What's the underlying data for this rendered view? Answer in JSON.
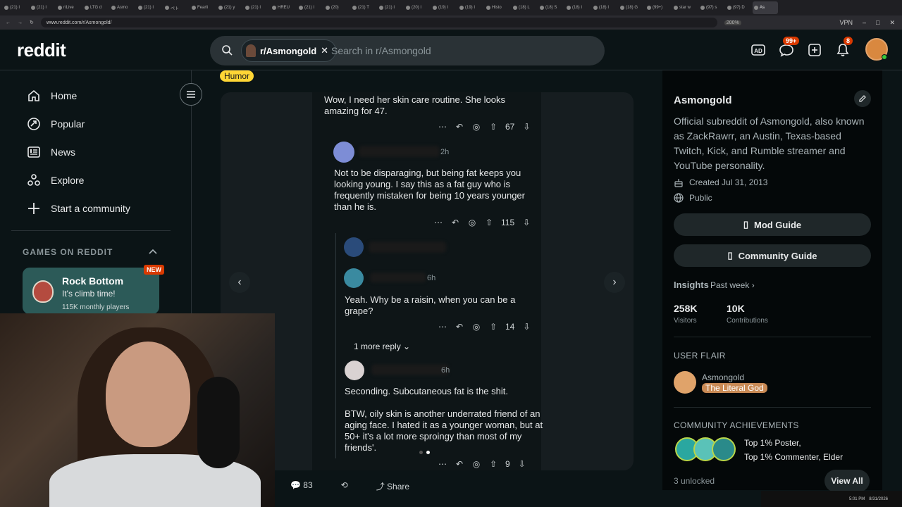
{
  "browser": {
    "tabs": [
      "(21) I",
      "(21) I",
      "r/Live",
      "LTG d",
      "Asmo",
      "(21) I",
      "ペト",
      "Fearli",
      "(21) y",
      "(21) I",
      "HREU",
      "(21) I",
      "(20)",
      "(21) T",
      "(21) I",
      "(20) I",
      "(19) I",
      "(19) I",
      "Histo",
      "(18) L",
      "(18) S",
      "(18) I",
      "(18) I",
      "(18) G",
      "(99+)",
      "star w",
      "(97) s",
      "(97) D",
      "As"
    ],
    "url": "www.reddit.com/r/Asmongold/",
    "zoom": "200%",
    "vpn": "VPN"
  },
  "header": {
    "logo": "reddit",
    "search_chip": "r/Asmongold",
    "search_placeholder": "Search in r/Asmongold",
    "chat_badge": "99+",
    "notif_badge": "8"
  },
  "leftnav": {
    "items": [
      {
        "label": "Home",
        "icon": "home-icon"
      },
      {
        "label": "Popular",
        "icon": "popular-icon"
      },
      {
        "label": "News",
        "icon": "news-icon"
      },
      {
        "label": "Explore",
        "icon": "explore-icon"
      },
      {
        "label": "Start a community",
        "icon": "plus-icon"
      }
    ],
    "games_title": "GAMES ON REDDIT",
    "game": {
      "name": "Rock Bottom",
      "tagline": "It's climb time!",
      "players": "115K monthly players",
      "badge": "NEW"
    }
  },
  "post": {
    "flair": "Humor",
    "comments": [
      {
        "text": "Wow, I need her skin care routine. She looks amazing for 47.",
        "votes": "67"
      },
      {
        "time": "2h",
        "text": "Not to be disparaging, but being fat keeps you looking young. I say this as a fat guy who is frequently mistaken for being 10 years younger than he is.",
        "votes": "115"
      },
      {
        "time": "6h",
        "text": "Yeah. Why be a raisin, when you can be a grape?",
        "votes": "14"
      },
      {
        "time": "6h",
        "text": "Seconding. Subcutaneous fat is the shit.\n\nBTW, oily skin is another underrated friend of an aging face. I hated it as a younger woman, but at 50+ it's a lot more sproingy than most of my friends'.",
        "votes": "9"
      }
    ],
    "more_reply": "1 more reply",
    "bottom_actions": {
      "comments": "83",
      "share": "Share"
    }
  },
  "sidebar": {
    "name": "Asmongold",
    "description": "Official subreddit of Asmongold, also known as ZackRawrr, an Austin, Texas-based Twitch, Kick, and Rumble streamer and YouTube personality.",
    "created": "Created Jul 31, 2013",
    "visibility": "Public",
    "mod_guide": "Mod Guide",
    "community_guide": "Community Guide",
    "insights": "Insights",
    "insights_period": "Past week",
    "visitors": "258K",
    "visitors_label": "Visitors",
    "contributions": "10K",
    "contributions_label": "Contributions",
    "user_flair_title": "USER FLAIR",
    "flair_user": "Asmongold",
    "flair_tag": "The Literal God",
    "achievements_title": "COMMUNITY ACHIEVEMENTS",
    "achievement_1": "Top 1% Poster,",
    "achievement_2": "Top 1% Commenter, Elder",
    "unlocked": "3 unlocked",
    "view_all": "View All"
  },
  "taskbar": {
    "time": "5:01 PM",
    "date": "8/31/2026"
  }
}
